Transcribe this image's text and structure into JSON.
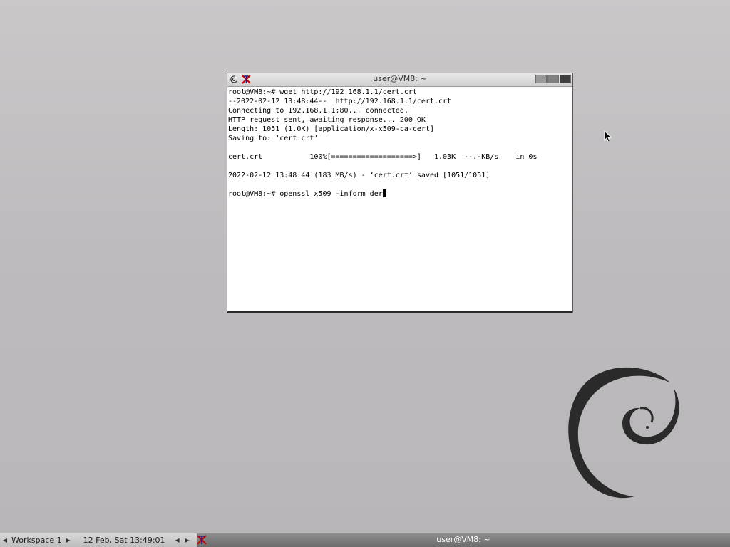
{
  "window": {
    "title": "user@VM8: ~",
    "lines": [
      "root@VM8:~# wget http://192.168.1.1/cert.crt",
      "--2022-02-12 13:48:44--  http://192.168.1.1/cert.crt",
      "Connecting to 192.168.1.1:80... connected.",
      "HTTP request sent, awaiting response... 200 OK",
      "Length: 1051 (1.0K) [application/x-x509-ca-cert]",
      "Saving to: ‘cert.crt’",
      "",
      "cert.crt           100%[===================>]   1.03K  --.-KB/s    in 0s",
      "",
      "2022-02-12 13:48:44 (183 MB/s) - ‘cert.crt’ saved [1051/1051]",
      ""
    ],
    "prompt_line": "root@VM8:~# openssl x509 -inform der"
  },
  "taskbar": {
    "workspace": "Workspace 1",
    "clock": "12 Feb, Sat 13:49:01",
    "task_label": "user@VM8: ~"
  },
  "icons": {
    "debian": "debian-swirl-icon",
    "xterm": "xterm-icon",
    "pointer": "mouse-pointer-icon"
  }
}
